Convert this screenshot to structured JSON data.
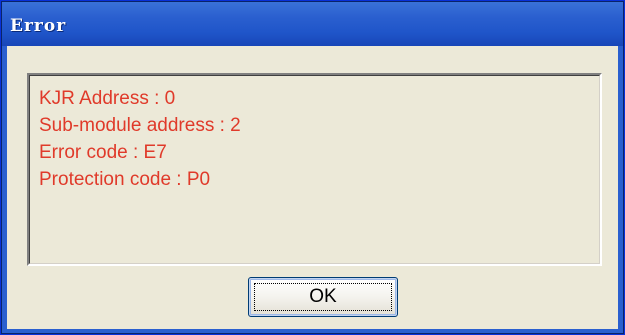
{
  "window": {
    "title": "Error"
  },
  "message": {
    "lines": [
      "KJR Address : 0",
      "Sub-module address : 2",
      "Error code : E7",
      "Protection code : P0"
    ],
    "text_color": "#e03a2a"
  },
  "buttons": {
    "ok_label": "OK"
  },
  "colors": {
    "titlebar": "#2a5fcf",
    "client_bg": "#ece9d8"
  }
}
